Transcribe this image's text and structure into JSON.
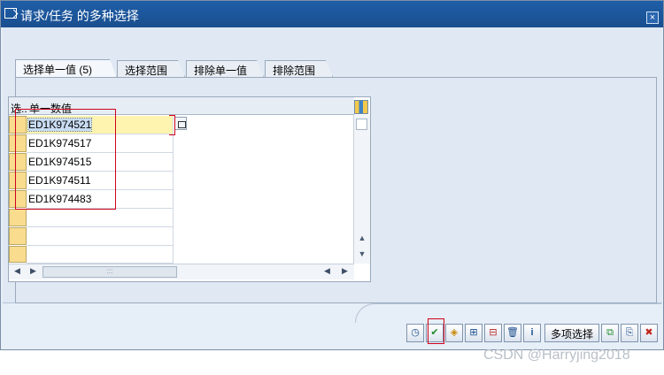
{
  "window": {
    "title": "请求/任务 的多种选择",
    "close_label": "×"
  },
  "tabs": [
    {
      "label": "选择单一值 (5)",
      "active": true
    },
    {
      "label": "选择范围",
      "active": false
    },
    {
      "label": "排除单一值",
      "active": false
    },
    {
      "label": "排除范围",
      "active": false
    }
  ],
  "grid": {
    "columns": [
      "选..",
      "单一数值"
    ],
    "rows": [
      {
        "value": "ED1K974521",
        "selected": true
      },
      {
        "value": "ED1K974517"
      },
      {
        "value": "ED1K974515"
      },
      {
        "value": "ED1K974511"
      },
      {
        "value": "ED1K974483"
      },
      {
        "value": ""
      },
      {
        "value": ""
      },
      {
        "value": ""
      }
    ],
    "scroll_grip": ":::"
  },
  "toolbar": {
    "buttons": [
      {
        "icon": "check-clock-icon",
        "symbol": "◷"
      },
      {
        "icon": "confirm-check-icon",
        "symbol": "✔"
      },
      {
        "icon": "select-multiple-icon",
        "symbol": "◈"
      },
      {
        "icon": "insert-row-icon",
        "symbol": "⊞"
      },
      {
        "icon": "delete-row-icon",
        "symbol": "⊟"
      },
      {
        "icon": "trash-icon",
        "symbol": "🗑"
      },
      {
        "icon": "info-icon",
        "symbol": "i"
      }
    ],
    "multi_select_label": "多项选择",
    "trailing_buttons": [
      {
        "icon": "copy-icon",
        "symbol": "⧉"
      },
      {
        "icon": "paste-icon",
        "symbol": "⎘"
      },
      {
        "icon": "cancel-icon",
        "symbol": "✖"
      }
    ]
  },
  "watermark": "CSDN @Harryjing2018",
  "colors": {
    "title_bar": "#1f5ea8",
    "annotation": "#d0021b",
    "row_selector": "#f9dc8e"
  }
}
